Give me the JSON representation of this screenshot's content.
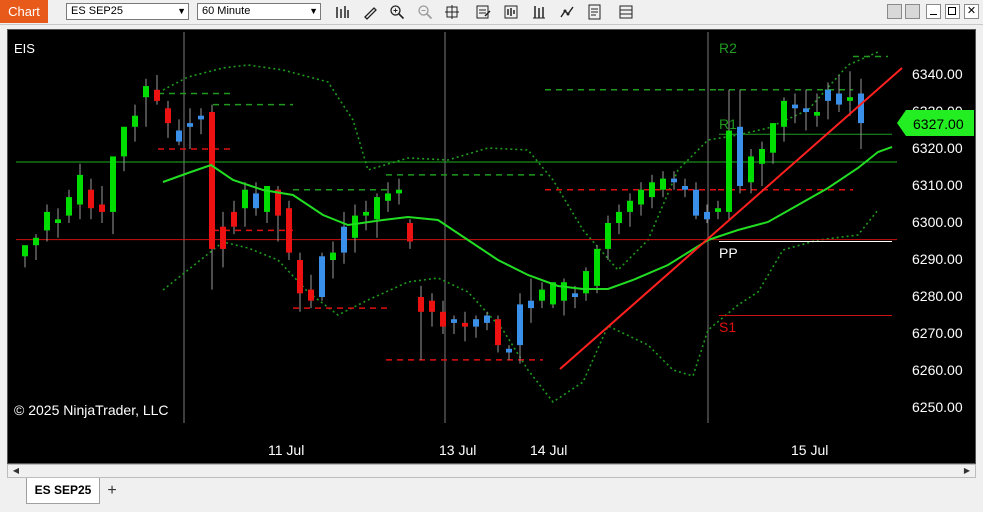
{
  "window": {
    "chart_tab": "Chart",
    "instrument": "ES SEP25",
    "interval": "60 Minute"
  },
  "toolbar_icons": [
    "bar-chart-icon",
    "draw-pencil-icon",
    "zoom-in-icon",
    "zoom-out-icon",
    "crosshair-icon",
    "properties-icon",
    "data-box-icon",
    "indicators-icon",
    "strategies-icon",
    "templates-icon",
    "chart-trader-icon"
  ],
  "chart": {
    "symbol_label": "EIS",
    "copyright": "© 2025 NinjaTrader, LLC",
    "pivot_labels": {
      "r2": "R2",
      "r1": "R1",
      "pp": "PP",
      "s1": "S1"
    },
    "current_price": "6327.00",
    "y_ticks": [
      "6340.00",
      "6330.00",
      "6320.00",
      "6310.00",
      "6300.00",
      "6290.00",
      "6280.00",
      "6270.00",
      "6260.00",
      "6250.00"
    ],
    "x_ticks": [
      "11 Jul",
      "13 Jul",
      "14 Jul",
      "15 Jul"
    ],
    "colors": {
      "up": "#00dd00",
      "down": "#ee1111",
      "neutral": "#3a8fe8",
      "ma": "#22dd22",
      "bands": "#1f9a1f",
      "trend": "#ff2020"
    }
  },
  "chart_data": {
    "type": "candlestick",
    "y_range": [
      6245,
      6345
    ],
    "candles": [
      {
        "o": 6291,
        "h": 6294,
        "l": 6288,
        "c": 6294,
        "d": "u"
      },
      {
        "o": 6294,
        "h": 6297,
        "l": 6290,
        "c": 6296,
        "d": "u"
      },
      {
        "o": 6298,
        "h": 6305,
        "l": 6295,
        "c": 6303,
        "d": "u"
      },
      {
        "o": 6300,
        "h": 6304,
        "l": 6296,
        "c": 6301,
        "d": "u"
      },
      {
        "o": 6302,
        "h": 6309,
        "l": 6300,
        "c": 6307,
        "d": "u"
      },
      {
        "o": 6305,
        "h": 6316,
        "l": 6301,
        "c": 6313,
        "d": "u"
      },
      {
        "o": 6309,
        "h": 6312,
        "l": 6301,
        "c": 6304,
        "d": "d"
      },
      {
        "o": 6305,
        "h": 6310,
        "l": 6300,
        "c": 6303,
        "d": "d"
      },
      {
        "o": 6303,
        "h": 6315,
        "l": 6297,
        "c": 6318,
        "d": "u"
      },
      {
        "o": 6318,
        "h": 6326,
        "l": 6314,
        "c": 6326,
        "d": "u"
      },
      {
        "o": 6326,
        "h": 6332,
        "l": 6322,
        "c": 6329,
        "d": "u"
      },
      {
        "o": 6334,
        "h": 6339,
        "l": 6326,
        "c": 6337,
        "d": "u"
      },
      {
        "o": 6336,
        "h": 6340,
        "l": 6332,
        "c": 6333,
        "d": "d"
      },
      {
        "o": 6331,
        "h": 6333,
        "l": 6323,
        "c": 6327,
        "d": "d"
      },
      {
        "o": 6325,
        "h": 6328,
        "l": 6321,
        "c": 6322,
        "d": "n"
      },
      {
        "o": 6326,
        "h": 6331,
        "l": 6320,
        "c": 6327,
        "d": "n"
      },
      {
        "o": 6329,
        "h": 6331,
        "l": 6324,
        "c": 6328,
        "d": "n"
      },
      {
        "o": 6330,
        "h": 6332,
        "l": 6282,
        "c": 6293,
        "d": "d"
      },
      {
        "o": 6299,
        "h": 6303,
        "l": 6288,
        "c": 6293,
        "d": "d"
      },
      {
        "o": 6303,
        "h": 6306,
        "l": 6297,
        "c": 6299,
        "d": "d"
      },
      {
        "o": 6304,
        "h": 6311,
        "l": 6299,
        "c": 6309,
        "d": "u"
      },
      {
        "o": 6308,
        "h": 6311,
        "l": 6302,
        "c": 6304,
        "d": "n"
      },
      {
        "o": 6303,
        "h": 6308,
        "l": 6300,
        "c": 6310,
        "d": "u"
      },
      {
        "o": 6309,
        "h": 6310,
        "l": 6295,
        "c": 6302,
        "d": "d"
      },
      {
        "o": 6304,
        "h": 6306,
        "l": 6290,
        "c": 6292,
        "d": "d"
      },
      {
        "o": 6290,
        "h": 6292,
        "l": 6276,
        "c": 6281,
        "d": "d"
      },
      {
        "o": 6282,
        "h": 6286,
        "l": 6277,
        "c": 6279,
        "d": "d"
      },
      {
        "o": 6280,
        "h": 6292,
        "l": 6279,
        "c": 6291,
        "d": "n"
      },
      {
        "o": 6290,
        "h": 6295,
        "l": 6285,
        "c": 6292,
        "d": "u"
      },
      {
        "o": 6292,
        "h": 6303,
        "l": 6289,
        "c": 6299,
        "d": "n"
      },
      {
        "o": 6296,
        "h": 6305,
        "l": 6292,
        "c": 6302,
        "d": "u"
      },
      {
        "o": 6302,
        "h": 6306,
        "l": 6298,
        "c": 6303,
        "d": "u"
      },
      {
        "o": 6301,
        "h": 6308,
        "l": 6296,
        "c": 6307,
        "d": "u"
      },
      {
        "o": 6306,
        "h": 6311,
        "l": 6303,
        "c": 6308,
        "d": "u"
      },
      {
        "o": 6308,
        "h": 6312,
        "l": 6305,
        "c": 6309,
        "d": "u"
      },
      {
        "o": 6300,
        "h": 6301,
        "l": 6293,
        "c": 6295,
        "d": "d"
      },
      {
        "o": 6280,
        "h": 6283,
        "l": 6263,
        "c": 6276,
        "d": "d"
      },
      {
        "o": 6279,
        "h": 6281,
        "l": 6272,
        "c": 6276,
        "d": "d"
      },
      {
        "o": 6276,
        "h": 6279,
        "l": 6270,
        "c": 6272,
        "d": "d"
      },
      {
        "o": 6273,
        "h": 6275,
        "l": 6270,
        "c": 6274,
        "d": "n"
      },
      {
        "o": 6272,
        "h": 6276,
        "l": 6268,
        "c": 6273,
        "d": "d"
      },
      {
        "o": 6272,
        "h": 6275,
        "l": 6269,
        "c": 6274,
        "d": "n"
      },
      {
        "o": 6273,
        "h": 6276,
        "l": 6271,
        "c": 6275,
        "d": "n"
      },
      {
        "o": 6274,
        "h": 6275,
        "l": 6265,
        "c": 6267,
        "d": "d"
      },
      {
        "o": 6265,
        "h": 6267,
        "l": 6263,
        "c": 6266,
        "d": "n"
      },
      {
        "o": 6267,
        "h": 6281,
        "l": 6262,
        "c": 6278,
        "d": "n"
      },
      {
        "o": 6277,
        "h": 6285,
        "l": 6273,
        "c": 6279,
        "d": "n"
      },
      {
        "o": 6279,
        "h": 6284,
        "l": 6277,
        "c": 6282,
        "d": "u"
      },
      {
        "o": 6278,
        "h": 6284,
        "l": 6277,
        "c": 6284,
        "d": "u"
      },
      {
        "o": 6279,
        "h": 6285,
        "l": 6275,
        "c": 6284,
        "d": "u"
      },
      {
        "o": 6281,
        "h": 6283,
        "l": 6277,
        "c": 6280,
        "d": "n"
      },
      {
        "o": 6281,
        "h": 6288,
        "l": 6279,
        "c": 6287,
        "d": "u"
      },
      {
        "o": 6283,
        "h": 6294,
        "l": 6281,
        "c": 6293,
        "d": "u"
      },
      {
        "o": 6293,
        "h": 6302,
        "l": 6290,
        "c": 6300,
        "d": "u"
      },
      {
        "o": 6300,
        "h": 6305,
        "l": 6297,
        "c": 6303,
        "d": "u"
      },
      {
        "o": 6303,
        "h": 6308,
        "l": 6299,
        "c": 6306,
        "d": "u"
      },
      {
        "o": 6305,
        "h": 6311,
        "l": 6302,
        "c": 6309,
        "d": "u"
      },
      {
        "o": 6307,
        "h": 6313,
        "l": 6304,
        "c": 6311,
        "d": "u"
      },
      {
        "o": 6309,
        "h": 6314,
        "l": 6307,
        "c": 6312,
        "d": "u"
      },
      {
        "o": 6312,
        "h": 6314,
        "l": 6309,
        "c": 6311,
        "d": "n"
      },
      {
        "o": 6310,
        "h": 6312,
        "l": 6307,
        "c": 6309,
        "d": "n"
      },
      {
        "o": 6309,
        "h": 6311,
        "l": 6301,
        "c": 6302,
        "d": "n"
      },
      {
        "o": 6301,
        "h": 6305,
        "l": 6300,
        "c": 6303,
        "d": "n"
      },
      {
        "o": 6303,
        "h": 6306,
        "l": 6301,
        "c": 6304,
        "d": "u"
      },
      {
        "o": 6303,
        "h": 6336,
        "l": 6301,
        "c": 6325,
        "d": "u"
      },
      {
        "o": 6326,
        "h": 6336,
        "l": 6308,
        "c": 6310,
        "d": "n"
      },
      {
        "o": 6311,
        "h": 6320,
        "l": 6308,
        "c": 6318,
        "d": "u"
      },
      {
        "o": 6316,
        "h": 6322,
        "l": 6310,
        "c": 6320,
        "d": "u"
      },
      {
        "o": 6319,
        "h": 6327,
        "l": 6316,
        "c": 6327,
        "d": "u"
      },
      {
        "o": 6326,
        "h": 6334,
        "l": 6322,
        "c": 6333,
        "d": "u"
      },
      {
        "o": 6332,
        "h": 6335,
        "l": 6327,
        "c": 6331,
        "d": "n"
      },
      {
        "o": 6331,
        "h": 6336,
        "l": 6325,
        "c": 6330,
        "d": "n"
      },
      {
        "o": 6330,
        "h": 6335,
        "l": 6326,
        "c": 6329,
        "d": "u"
      },
      {
        "o": 6333,
        "h": 6338,
        "l": 6328,
        "c": 6336,
        "d": "n"
      },
      {
        "o": 6335,
        "h": 6340,
        "l": 6330,
        "c": 6332,
        "d": "n"
      },
      {
        "o": 6333,
        "h": 6341,
        "l": 6329,
        "c": 6334,
        "d": "u"
      },
      {
        "o": 6335,
        "h": 6339,
        "l": 6320,
        "c": 6327,
        "d": "n"
      }
    ],
    "moving_average": [
      6316,
      6317,
      6318,
      6319,
      6317,
      6315,
      6313,
      6311,
      6310,
      6309,
      6308,
      6307,
      6305,
      6303,
      6302,
      6301,
      6301,
      6302,
      6302,
      6301,
      6300,
      6299,
      6297,
      6294,
      6291,
      6288,
      6285,
      6283,
      6282,
      6282,
      6282,
      6283,
      6283,
      6285,
      6287,
      6289,
      6291,
      6294,
      6296,
      6298,
      6300,
      6303,
      6304,
      6306,
      6308,
      6310,
      6312,
      6314,
      6316,
      6318,
      6320,
      6321
    ],
    "pivots": {
      "r2": 6355,
      "r1": 6324,
      "pp": 6295,
      "s1": 6275
    },
    "horizontal_lines": [
      6316.5,
      6295.5
    ],
    "trendline": [
      [
        6260,
        6295
      ],
      [
        6295,
        6342
      ]
    ],
    "current_price": 6327
  }
}
